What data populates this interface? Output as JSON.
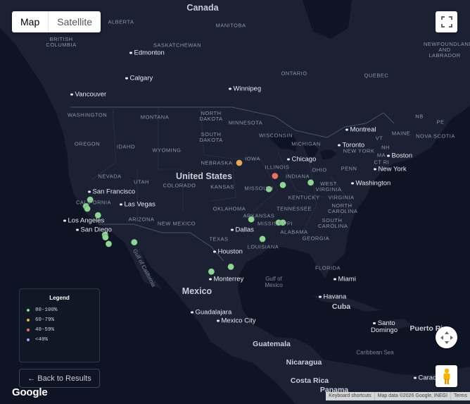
{
  "map_type": {
    "map_label": "Map",
    "satellite_label": "Satellite",
    "selected": "Map"
  },
  "labels": {
    "countries": [
      "Canada",
      "United States",
      "Mexico",
      "Cuba",
      "Guatemala",
      "Nicaragua",
      "Costa Rica",
      "Panama",
      "Puerto Rico"
    ],
    "regions": [
      "ALBERTA",
      "MANITOBA",
      "BRITISH COLUMBIA",
      "SASKATCHEWAN",
      "ONTARIO",
      "QUEBEC",
      "NEWFOUNDLAND AND LABRADOR",
      "NB",
      "PE",
      "NOVA SCOTIA",
      "WASHINGTON",
      "MONTANA",
      "NORTH DAKOTA",
      "MINNESOTA",
      "OREGON",
      "IDAHO",
      "WYOMING",
      "SOUTH DAKOTA",
      "WISCONSIN",
      "MICHIGAN",
      "NEW YORK",
      "VT",
      "NH",
      "MAINE",
      "MA",
      "CT",
      "RI",
      "NEVADA",
      "UTAH",
      "COLORADO",
      "NEBRASKA",
      "IOWA",
      "ILLINOIS",
      "INDIANA",
      "OHIO",
      "PENN",
      "CALIFORNIA",
      "KANSAS",
      "MISSOURI",
      "WEST VIRGINIA",
      "VIRGINIA",
      "KENTUCKY",
      "ARIZONA",
      "NEW MEXICO",
      "OKLAHOMA",
      "ARKANSAS",
      "TENNESSEE",
      "NORTH CAROLINA",
      "SOUTH CAROLINA",
      "MISSISSIPPI",
      "ALABAMA",
      "GEORGIA",
      "TEXAS",
      "LOUISIANA",
      "FLORIDA"
    ],
    "cities": [
      "Edmonton",
      "Calgary",
      "Vancouver",
      "Winnipeg",
      "Montreal",
      "Toronto",
      "Boston",
      "New York",
      "Chicago",
      "Washington",
      "San Francisco",
      "Las Vegas",
      "Los Angeles",
      "San Diego",
      "Dallas",
      "Houston",
      "Monterrey",
      "Miami",
      "Havana",
      "Guadalajara",
      "Mexico City",
      "Santo Domingo",
      "Caracas"
    ],
    "water": [
      "Gulf of California",
      "Gulf of Mexico",
      "Caribbean Sea"
    ]
  },
  "markers": [
    {
      "id": "sf1",
      "lat": 38.6,
      "lon": -121.5,
      "color": "#8fd694",
      "range": "80-100%"
    },
    {
      "id": "sf2",
      "lat": 37.8,
      "lon": -122.4,
      "color": "#8fd694",
      "range": "80-100%"
    },
    {
      "id": "sf3",
      "lat": 37.5,
      "lon": -122.1,
      "color": "#8fd694",
      "range": "80-100%"
    },
    {
      "id": "ca1",
      "lat": 36.7,
      "lon": -119.8,
      "color": "#8fd694",
      "range": "80-100%"
    },
    {
      "id": "la1",
      "lat": 34.3,
      "lon": -118.3,
      "color": "#8fd694",
      "range": "80-100%"
    },
    {
      "id": "la2",
      "lat": 34.0,
      "lon": -118.2,
      "color": "#8fd694",
      "range": "80-100%"
    },
    {
      "id": "sd1",
      "lat": 33.2,
      "lon": -117.5,
      "color": "#8fd694",
      "range": "80-100%"
    },
    {
      "id": "phx",
      "lat": 33.4,
      "lon": -112.0,
      "color": "#8fd694",
      "range": "80-100%"
    },
    {
      "id": "hou1",
      "lat": 29.8,
      "lon": -95.4,
      "color": "#8fd694",
      "range": "80-100%"
    },
    {
      "id": "hou2",
      "lat": 30.4,
      "lon": -91.2,
      "color": "#8fd694",
      "range": "80-100%"
    },
    {
      "id": "nash",
      "lat": 36.2,
      "lon": -86.8,
      "color": "#8fd694",
      "range": "80-100%"
    },
    {
      "id": "atl",
      "lat": 33.8,
      "lon": -84.4,
      "color": "#8fd694",
      "range": "80-100%"
    },
    {
      "id": "clt1",
      "lat": 35.8,
      "lon": -80.9,
      "color": "#8fd694",
      "range": "80-100%"
    },
    {
      "id": "clt2",
      "lat": 35.8,
      "lon": -80.0,
      "color": "#8fd694",
      "range": "80-100%"
    },
    {
      "id": "cols",
      "lat": 39.9,
      "lon": -83.0,
      "color": "#8fd694",
      "range": "80-100%"
    },
    {
      "id": "pitt",
      "lat": 40.4,
      "lon": -80.0,
      "color": "#8fd694",
      "range": "80-100%"
    },
    {
      "id": "nyc",
      "lat": 40.7,
      "lon": -74.0,
      "color": "#8fd694",
      "range": "80-100%"
    },
    {
      "id": "msn",
      "lat": 43.1,
      "lon": -89.4,
      "color": "#e3a85a",
      "range": "60-79%"
    },
    {
      "id": "cle",
      "lat": 41.5,
      "lon": -81.7,
      "color": "#e8706b",
      "range": "40-59%"
    }
  ],
  "legend": {
    "title": "Legend",
    "items": [
      {
        "label": "80-100%",
        "color": "#8fd694"
      },
      {
        "label": "60-79%",
        "color": "#e3a85a"
      },
      {
        "label": "40-59%",
        "color": "#e8706b"
      },
      {
        "label": "<40%",
        "color": "#b497e8"
      }
    ]
  },
  "back_button": {
    "label": "← Back to Results"
  },
  "footer": {
    "keyboard": "Keyboard shortcuts",
    "map_data": "Map data ©2026 Google, INEGI",
    "terms": "Terms"
  },
  "brand": "Google",
  "icons": {
    "fullscreen": "fullscreen-icon",
    "camera": "camera-control-icon",
    "pegman": "pegman-icon"
  }
}
